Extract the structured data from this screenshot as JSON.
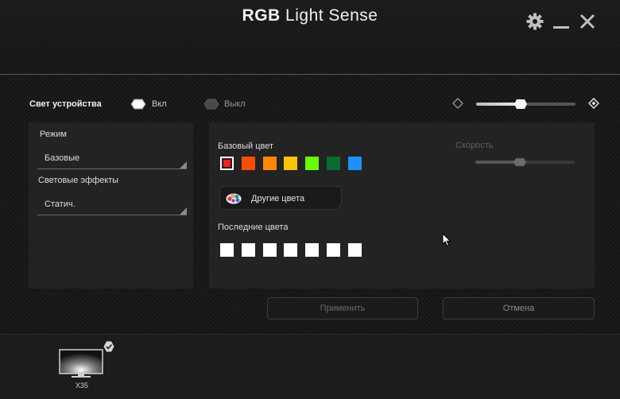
{
  "app": {
    "title_bold": "RGB",
    "title_rest": "Light Sense"
  },
  "window_controls": {
    "settings_icon": "gear-icon",
    "minimize_icon": "minimize-icon",
    "close_icon": "close-icon"
  },
  "device_light": {
    "label": "Свет устройства",
    "on_label": "Вкл",
    "off_label": "Выкл",
    "state": "on"
  },
  "brightness": {
    "value_fraction": 0.45,
    "low_icon": "brightness-low-icon",
    "high_icon": "brightness-high-icon"
  },
  "mode": {
    "label": "Режим",
    "selected": "Базовые"
  },
  "effects": {
    "label": "Световые эффекты",
    "selected": "Статич."
  },
  "base_color": {
    "label": "Базовый цвет",
    "selected_index": 0,
    "swatches": [
      "#ff1a1a",
      "#ff4d00",
      "#ff8800",
      "#ffc400",
      "#66ff00",
      "#0a6b2e",
      "#1e90ff"
    ]
  },
  "other_colors": {
    "label": "Другие цвета",
    "icon": "palette-icon"
  },
  "recent_colors": {
    "label": "Последние цвета",
    "swatches": [
      "#ffffff",
      "#ffffff",
      "#ffffff",
      "#ffffff",
      "#ffffff",
      "#ffffff",
      "#ffffff"
    ]
  },
  "speed": {
    "label": "Скорость",
    "value_fraction": 0.45,
    "enabled": false
  },
  "buttons": {
    "apply": "Применить",
    "cancel": "Отмена"
  },
  "device": {
    "name": "X35",
    "icon": "monitor-icon",
    "selected": true
  }
}
